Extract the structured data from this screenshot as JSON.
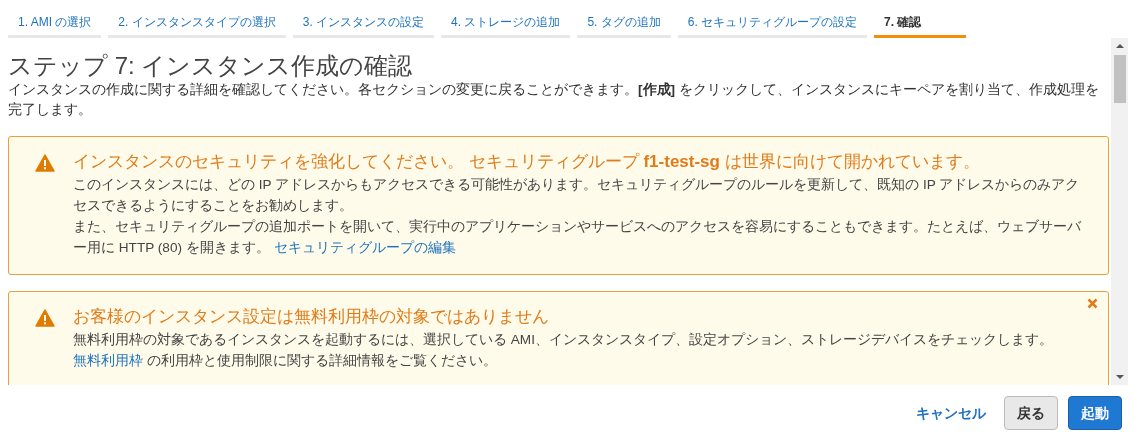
{
  "tabs": [
    {
      "label": "1. AMI の選択",
      "selected": false
    },
    {
      "label": "2. インスタンスタイプの選択",
      "selected": false
    },
    {
      "label": "3. インスタンスの設定",
      "selected": false
    },
    {
      "label": "4. ストレージの追加",
      "selected": false
    },
    {
      "label": "5. タグの追加",
      "selected": false
    },
    {
      "label": "6. セキュリティグループの設定",
      "selected": false
    },
    {
      "label": "7. 確認",
      "selected": true
    }
  ],
  "title": "ステップ 7: インスタンス作成の確認",
  "description": "インスタンスの作成に関する詳細を確認してください。各セクションの変更に戻ることができます。**[作成]** をクリックして、インスタンスにキーペアを割り当て、作成処理を完了します。",
  "alerts": [
    {
      "kind": "warning",
      "dismissible": false,
      "title": "インスタンスのセキュリティを強化してください。 セキュリティグループ **f1-test-sg** は世界に向けて開かれています。",
      "paragraphs": [
        [
          {
            "kind": "text",
            "text": "このインスタンスには、どの IP アドレスからもアクセスできる可能性があります。セキュリティグループのルールを更新して、既知の IP アドレスからのみアクセスできるようにすることをお勧めします。"
          }
        ],
        [
          {
            "kind": "text",
            "text": "また、セキュリティグループの追加ポートを開いて、実行中のアプリケーションやサービスへのアクセスを容易にすることもできます。たとえば、ウェブサーバー用に HTTP (80) を開きます。 "
          },
          {
            "kind": "link",
            "text": "セキュリティグループの編集"
          }
        ]
      ]
    },
    {
      "kind": "warning",
      "dismissible": true,
      "title": "お客様のインスタンス設定は無料利用枠の対象ではありません",
      "paragraphs": [
        [
          {
            "kind": "text",
            "text": "無料利用枠の対象であるインスタンスを起動するには、選択している AMI、インスタンスタイプ、設定オプション、ストレージデバイスをチェックします。"
          }
        ],
        [
          {
            "kind": "link",
            "text": "無料利用枠"
          },
          {
            "kind": "text",
            "text": " の利用枠と使用制限に関する詳細情報をご覧ください。"
          }
        ]
      ]
    }
  ],
  "buttons": [
    {
      "kind": "link",
      "label": "キャンセル"
    },
    {
      "kind": "secondary",
      "label": "戻る"
    },
    {
      "kind": "primary",
      "label": "起動"
    }
  ]
}
